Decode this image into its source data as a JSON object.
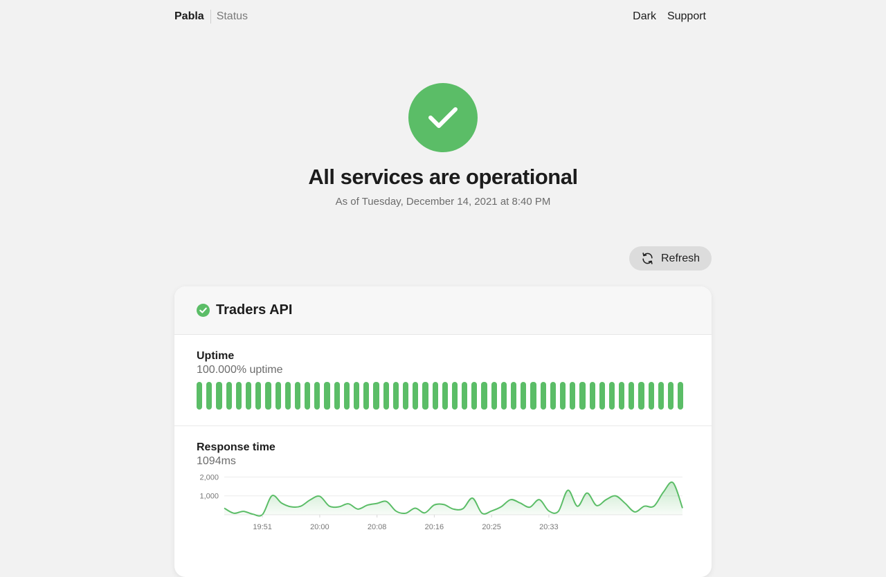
{
  "header": {
    "brand": "Pabla",
    "page": "Status",
    "nav": {
      "dark": "Dark",
      "support": "Support"
    }
  },
  "hero": {
    "title": "All services are operational",
    "subtitle": "As of Tuesday, December 14, 2021 at 8:40 PM",
    "status": "operational",
    "color": "#5bbd67"
  },
  "refresh": {
    "label": "Refresh",
    "icon": "refresh-icon"
  },
  "service": {
    "name": "Traders API",
    "status_icon": "check-circle-icon",
    "uptime": {
      "title": "Uptime",
      "value": "100.000% uptime",
      "bar_count": 50,
      "bar_status": "up"
    },
    "response": {
      "title": "Response time",
      "value": "1094ms"
    }
  },
  "chart_data": {
    "type": "area",
    "title": "",
    "xlabel": "",
    "ylabel": "",
    "ylim": [
      0,
      2200
    ],
    "yticks": [
      1000,
      2000
    ],
    "ytick_labels": [
      "1,000",
      "2,000"
    ],
    "xtick_labels": [
      "19:51",
      "20:00",
      "20:08",
      "20:16",
      "20:25",
      "20:33"
    ],
    "xtick_positions": [
      4,
      10,
      16,
      22,
      28,
      34
    ],
    "color": "#5bbd67",
    "grid": true,
    "series": [
      {
        "values": [
          350,
          80,
          180,
          30,
          10,
          1010,
          620,
          420,
          450,
          790,
          980,
          460,
          420,
          580,
          300,
          510,
          600,
          700,
          190,
          80,
          350,
          100,
          520,
          540,
          300,
          320,
          880,
          80,
          200,
          420,
          800,
          620,
          400,
          800,
          200,
          180,
          1300,
          450,
          1150,
          490,
          800,
          1000,
          600,
          150,
          450,
          450,
          1200,
          1700,
          350
        ]
      }
    ]
  }
}
